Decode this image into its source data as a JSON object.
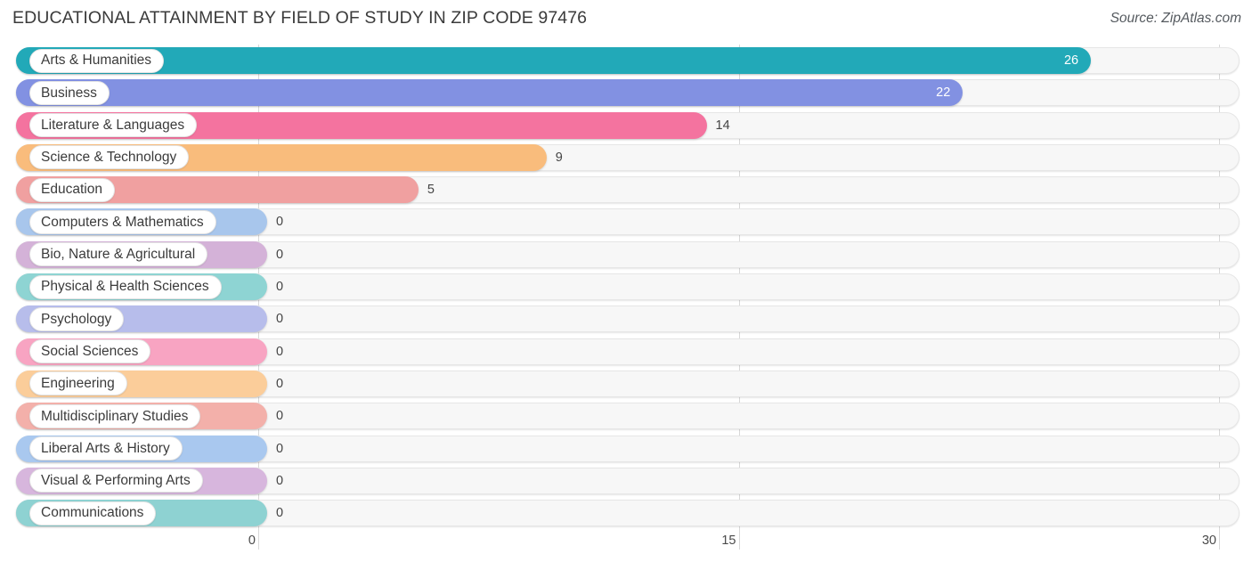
{
  "header": {
    "title": "EDUCATIONAL ATTAINMENT BY FIELD OF STUDY IN ZIP CODE 97476",
    "source": "Source: ZipAtlas.com"
  },
  "chart_data": {
    "type": "bar",
    "orientation": "horizontal",
    "title": "EDUCATIONAL ATTAINMENT BY FIELD OF STUDY IN ZIP CODE 97476",
    "xlabel": "",
    "ylabel": "",
    "xlim": [
      0,
      30
    ],
    "xticks": [
      0,
      15,
      30
    ],
    "xtick_labels": [
      "0",
      "15",
      "30"
    ],
    "grid": true,
    "legend": "none",
    "categories": [
      "Arts & Humanities",
      "Business",
      "Literature & Languages",
      "Science & Technology",
      "Education",
      "Computers & Mathematics",
      "Bio, Nature & Agricultural",
      "Physical & Health Sciences",
      "Psychology",
      "Social Sciences",
      "Engineering",
      "Multidisciplinary Studies",
      "Liberal Arts & History",
      "Visual & Performing Arts",
      "Communications"
    ],
    "values": [
      26,
      22,
      14,
      9,
      5,
      0,
      0,
      0,
      0,
      0,
      0,
      0,
      0,
      0,
      0
    ],
    "value_labels": [
      "26",
      "22",
      "14",
      "9",
      "5",
      "0",
      "0",
      "0",
      "0",
      "0",
      "0",
      "0",
      "0",
      "0",
      "0"
    ],
    "colors": [
      "#22a9b8",
      "#8291e2",
      "#f4739f",
      "#f9bc7c",
      "#f0a0a0",
      "#a8c6ec",
      "#d4b2d8",
      "#8ed4d3",
      "#b7bdeb",
      "#f8a4c2",
      "#fbcd9a",
      "#f3b0aa",
      "#a9c8ef",
      "#d7b6dd",
      "#8ed2d2"
    ]
  }
}
